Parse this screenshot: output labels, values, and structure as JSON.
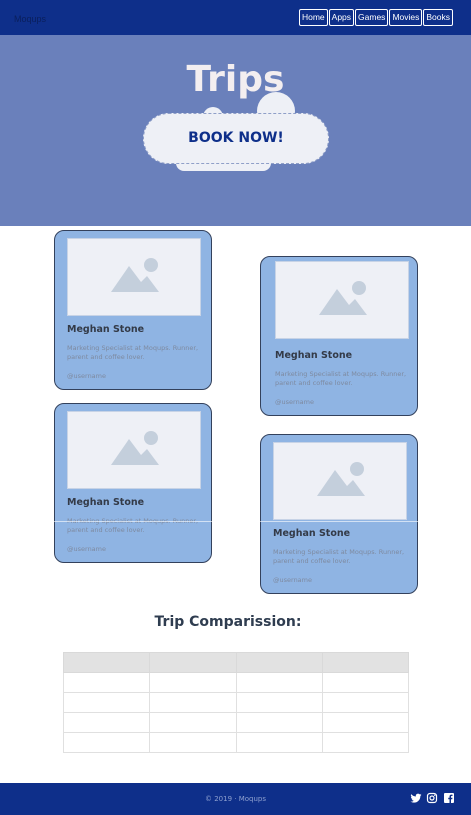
{
  "navbar": {
    "logo": "Moqups",
    "links": [
      "Home",
      "Apps",
      "Games",
      "Movies",
      "Books"
    ]
  },
  "hero": {
    "title": "Trips",
    "button": "BOOK NOW!"
  },
  "cards": [
    {
      "name": "Meghan Stone",
      "description": "Marketing Specialist at Moqups. Runner, parent and coffee lover.",
      "username": "@username",
      "image_icon": "image-placeholder-icon"
    },
    {
      "name": "Meghan Stone",
      "description": "Marketing Specialist at Moqups. Runner, parent and coffee lover.",
      "username": "@username",
      "image_icon": "image-placeholder-icon"
    },
    {
      "name": "Meghan Stone",
      "description": "Marketing Specialist at Moqups. Runner, parent and coffee lover.",
      "username": "@username",
      "image_icon": "image-placeholder-icon"
    },
    {
      "name": "Meghan Stone",
      "description": "Marketing Specialist at Moqups. Runner, parent and coffee lover.",
      "username": "@username",
      "image_icon": "image-placeholder-icon"
    }
  ],
  "comparison": {
    "title": "Trip Comparission:",
    "headers": [
      "",
      "",
      "",
      ""
    ],
    "rows": [
      [
        "",
        "",
        "",
        ""
      ],
      [
        "",
        "",
        "",
        ""
      ],
      [
        "",
        "",
        "",
        ""
      ],
      [
        "",
        "",
        "",
        ""
      ]
    ]
  },
  "footer": {
    "copyright": "© 2019 · Moqups",
    "social_icons": [
      "twitter-icon",
      "instagram-icon",
      "facebook-icon"
    ]
  },
  "colors": {
    "brand": "#0e2f8a",
    "hero_bg": "#6a80bb",
    "card_bg": "#8fb4e3",
    "text_dark": "#2f3d50"
  }
}
